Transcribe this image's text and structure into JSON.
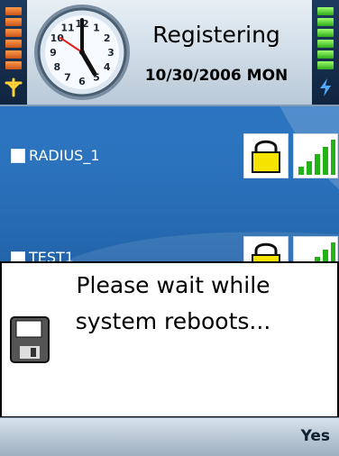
{
  "header": {
    "status": "Registering",
    "date": "10/30/2006 MON"
  },
  "clock": {
    "numbers": [
      "12",
      "1",
      "2",
      "3",
      "4",
      "5",
      "6",
      "7",
      "8",
      "9",
      "10",
      "11"
    ]
  },
  "list": [
    {
      "label": "RADIUS_1"
    },
    {
      "label": "TEST1"
    }
  ],
  "dialog": {
    "line1": "Please wait while",
    "line2": "system reboots..."
  },
  "softkeys": {
    "right": "Yes"
  },
  "colors": {
    "lock": "#f4e400",
    "signal": "#22b316",
    "battery_left": "#ff8a3d",
    "battery_right": "#57d63b"
  }
}
